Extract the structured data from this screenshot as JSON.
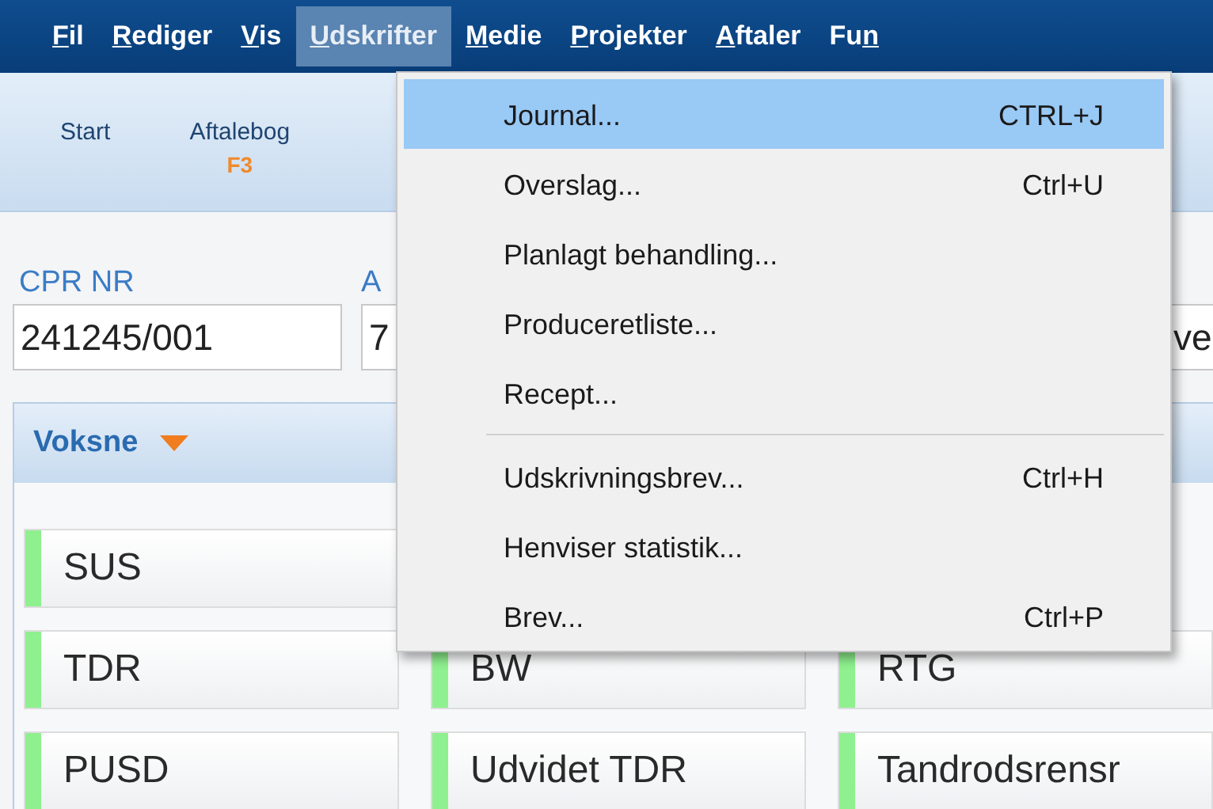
{
  "menu_bar": [
    {
      "key": "F",
      "post": "il",
      "selected": false
    },
    {
      "key": "R",
      "post": "ediger",
      "selected": false
    },
    {
      "key": "V",
      "post": "is",
      "selected": false
    },
    {
      "key": "U",
      "post": "dskrifter",
      "selected": true
    },
    {
      "key": "M",
      "post": "edie",
      "selected": false
    },
    {
      "key": "P",
      "post": "rojekter",
      "selected": false
    },
    {
      "key": "A",
      "post": "ftaler",
      "selected": false
    },
    {
      "pre": "Fu",
      "key": "n",
      "selected": false
    }
  ],
  "toolbar": [
    {
      "label": "Start"
    },
    {
      "label": "Aftalebog",
      "key": "F3"
    }
  ],
  "fields": [
    {
      "label": "CPR NR",
      "value": "241245/001"
    },
    {
      "label": "A",
      "value": "7"
    },
    {
      "value": "ve"
    }
  ],
  "panel": {
    "title": "Voksne",
    "rows": [
      [
        "SUS"
      ],
      [
        "TDR",
        "BW",
        "RTG"
      ],
      [
        "PUSD",
        "Udvidet TDR",
        "Tandrodsrensr"
      ]
    ]
  },
  "dropdown": [
    {
      "kind": "item",
      "label": "Journal...",
      "shortcut": "CTRL+J",
      "selected": true
    },
    {
      "kind": "item",
      "label": "Overslag...",
      "shortcut": "Ctrl+U",
      "selected": false
    },
    {
      "kind": "item",
      "label": "Planlagt behandling...",
      "selected": false
    },
    {
      "kind": "item",
      "label": "Produceretliste...",
      "selected": false
    },
    {
      "kind": "item",
      "label": "Recept...",
      "selected": false
    },
    {
      "kind": "separator"
    },
    {
      "kind": "item",
      "label": "Udskrivningsbrev...",
      "shortcut": "Ctrl+H",
      "selected": false
    },
    {
      "kind": "item",
      "label": "Henviser statistik...",
      "selected": false
    },
    {
      "kind": "item",
      "label": "Brev...",
      "shortcut": "Ctrl+P",
      "selected": false
    }
  ]
}
